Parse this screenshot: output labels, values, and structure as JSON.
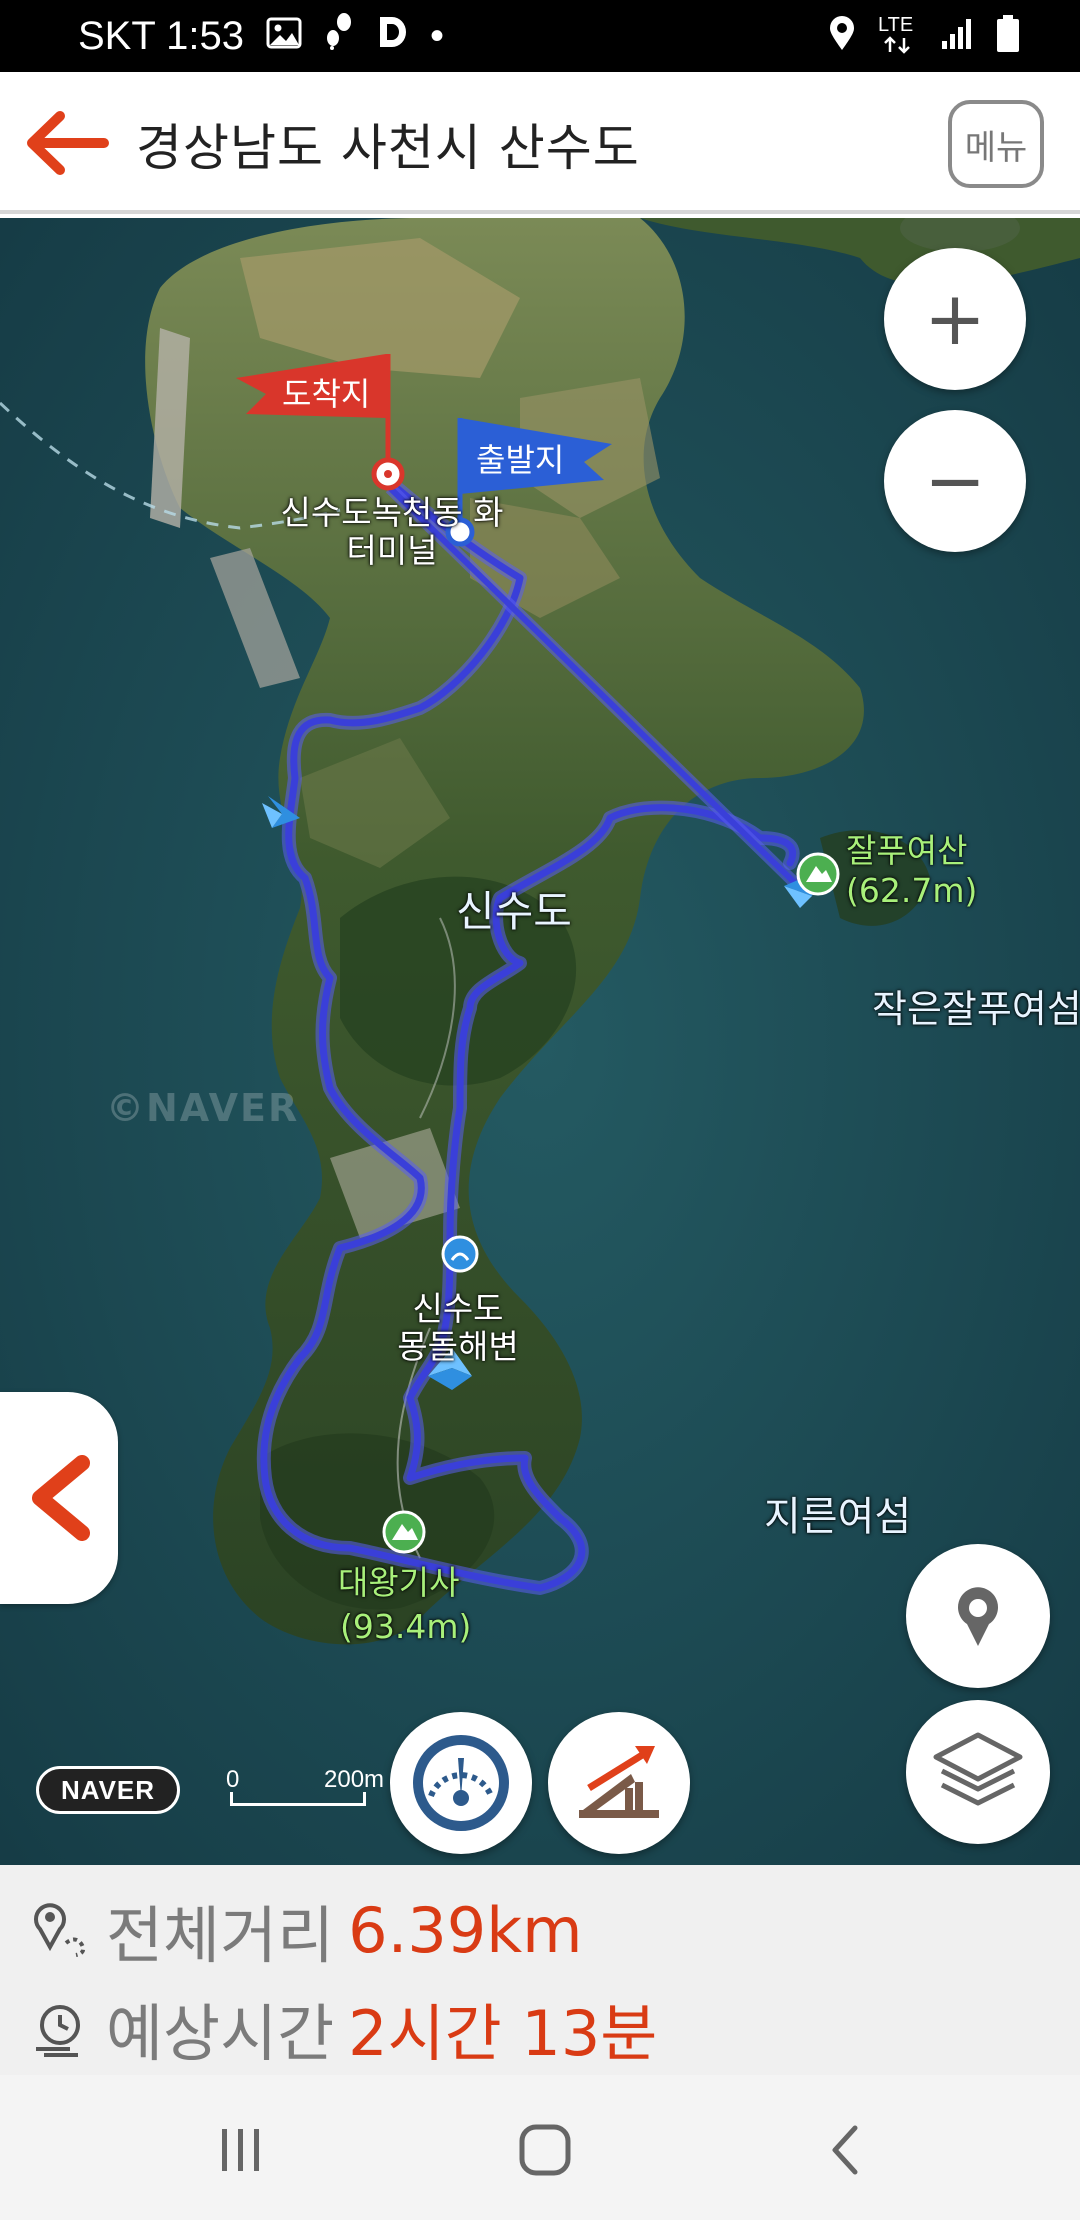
{
  "status_bar": {
    "carrier_time": "SKT 1:53",
    "dot": "•",
    "network": "LTE",
    "icons": [
      "gallery-icon",
      "walk-icon",
      "d-app-icon",
      "location-icon",
      "signal-icon",
      "battery-icon"
    ]
  },
  "header": {
    "back_icon": "arrow-left-icon",
    "title": "경상남도 사천시 산수도",
    "menu_label": "메뉴"
  },
  "map": {
    "arrival_flag": "도착지",
    "start_flag": "출발지",
    "terminal_label": "신수도녹천동 화\n터미널",
    "peak1_name": "잘푸여산",
    "peak1_height": "(62.7m)",
    "small_island": "작은잘푸여섬",
    "island_name": "신수도",
    "watermark": "©NAVER",
    "beach_label": "신수도\n몽돌해변",
    "peak2_name": "대왕기사",
    "peak2_height": "(93.4m)",
    "rock_island": "지른여섬",
    "logo_text": "NAVER",
    "scale_zero": "0",
    "scale_distance": "200m",
    "route_color": "#3a3fd9",
    "flag_red": "#d9362b",
    "flag_blue": "#2b5fd6",
    "buttons": {
      "zoom_in": "+",
      "zoom_out": "−",
      "collapse_icon": "chevron-left-icon",
      "location_icon": "map-pin-icon",
      "layers_icon": "layers-icon",
      "speed_icon": "speedometer-icon",
      "elevation_icon": "elevation-icon"
    }
  },
  "info": {
    "distance_label": "전체거리",
    "distance_value": "6.39km",
    "time_label": "예상시간",
    "time_value": "2시간 13분"
  },
  "navbar": {
    "recent_icon": "recent-apps-icon",
    "home_icon": "home-icon",
    "back_icon": "back-icon"
  }
}
